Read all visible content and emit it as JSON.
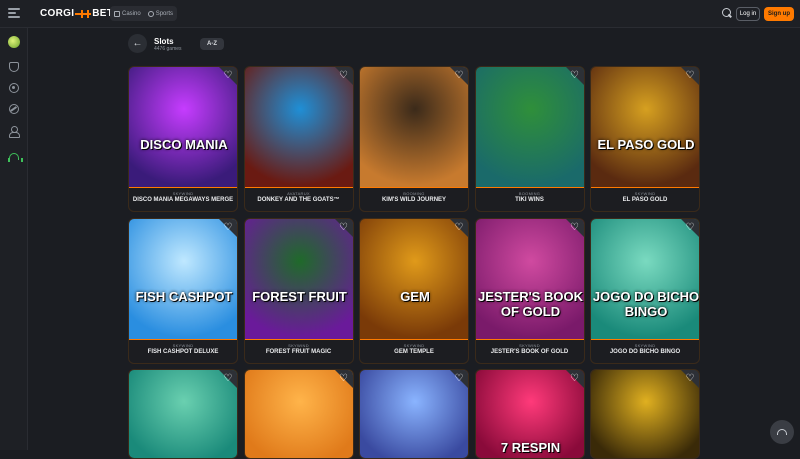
{
  "header": {
    "logo_left": "CORGI",
    "logo_right": "BET",
    "nav": [
      {
        "label": "Casino",
        "icon": "casino-icon"
      },
      {
        "label": "Sports",
        "icon": "sports-icon"
      }
    ],
    "login_label": "Log in",
    "signup_label": "Sign up",
    "accent": "#ff7a00"
  },
  "sidebar": {
    "items": [
      {
        "icon": "tennis-ball-icon"
      },
      {
        "icon": "shield-icon"
      },
      {
        "icon": "casino-chip-icon"
      },
      {
        "icon": "sports-ball-icon"
      },
      {
        "icon": "user-icon"
      },
      {
        "icon": "headset-icon"
      }
    ]
  },
  "page": {
    "title": "Slots",
    "count": "4476 games",
    "sort_label": "A-Z"
  },
  "games": [
    {
      "provider": "SKYWIND",
      "name": "DISCO MANIA MEGAWAYS MERGE",
      "art_text": "DISCO MANIA",
      "colors": [
        "#3a1b7a",
        "#c63cff"
      ]
    },
    {
      "provider": "AVATARUX",
      "name": "DONKEY AND THE GOATS™",
      "art_text": "",
      "colors": [
        "#6a1a12",
        "#1f8fd6"
      ]
    },
    {
      "provider": "BOOMING",
      "name": "KIM'S WILD JOURNEY",
      "art_text": "",
      "colors": [
        "#c77a2e",
        "#3b2a1a"
      ]
    },
    {
      "provider": "BOOMING",
      "name": "TIKI WINS",
      "art_text": "",
      "colors": [
        "#1a6a6a",
        "#2f8f3a"
      ]
    },
    {
      "provider": "SKYWIND",
      "name": "EL PASO GOLD",
      "art_text": "EL PASO GOLD",
      "colors": [
        "#5a2a10",
        "#d6a020"
      ]
    },
    {
      "provider": "SKYWIND",
      "name": "FISH CASHPOT DELUXE",
      "art_text": "FISH CASHPOT",
      "colors": [
        "#2a8ee0",
        "#bfe8ff"
      ]
    },
    {
      "provider": "SKYWIND",
      "name": "FOREST FRUIT MAGIC",
      "art_text": "FOREST FRUIT",
      "colors": [
        "#6a1a9a",
        "#1f6a2a"
      ]
    },
    {
      "provider": "SKYWIND",
      "name": "GEM TEMPLE",
      "art_text": "GEM",
      "colors": [
        "#7a3a08",
        "#e09a1a"
      ]
    },
    {
      "provider": "SKYWIND",
      "name": "JESTER'S BOOK OF GOLD",
      "art_text": "JESTER'S BOOK OF GOLD",
      "colors": [
        "#7a1a6a",
        "#d04aa0"
      ]
    },
    {
      "provider": "SKYWIND",
      "name": "JOGO DO BICHO BINGO",
      "art_text": "JOGO DO BICHO BINGO",
      "colors": [
        "#1a8a7a",
        "#7adac0"
      ]
    },
    {
      "provider": "",
      "name": "",
      "art_text": "",
      "colors": [
        "#1a8a7a",
        "#6ad0b0"
      ]
    },
    {
      "provider": "",
      "name": "",
      "art_text": "",
      "colors": [
        "#e07a1a",
        "#ffb44a"
      ]
    },
    {
      "provider": "",
      "name": "",
      "art_text": "",
      "colors": [
        "#3a4aa0",
        "#8ab4ff"
      ]
    },
    {
      "provider": "",
      "name": "",
      "art_text": "7 RESPIN",
      "colors": [
        "#8a0a3a",
        "#ff3a7a"
      ]
    },
    {
      "provider": "",
      "name": "",
      "art_text": "",
      "colors": [
        "#3a2a08",
        "#e0b020"
      ]
    }
  ]
}
